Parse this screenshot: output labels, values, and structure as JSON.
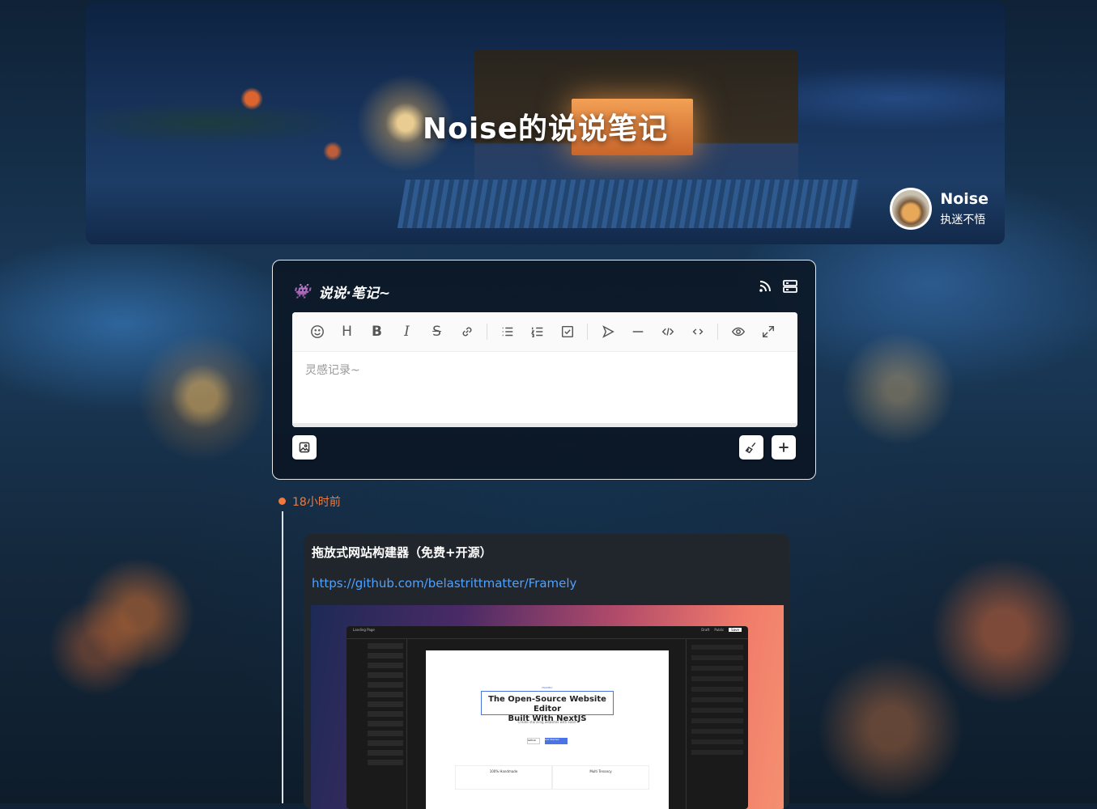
{
  "banner": {
    "title": "Noise的说说笔记"
  },
  "author": {
    "name": "Noise",
    "motto": "执迷不悟"
  },
  "card": {
    "title": "说说·笔记~",
    "placeholder": "灵感记录~"
  },
  "toolbar": {
    "icons": [
      "emoji-icon",
      "heading-icon",
      "bold-icon",
      "italic-icon",
      "strike-icon",
      "link-icon",
      "list-icon",
      "ordered-list-icon",
      "check-icon",
      "quote-icon",
      "line-icon",
      "code-icon",
      "inline-code-icon",
      "preview-icon",
      "fullscreen-icon"
    ],
    "heading": "H",
    "bold": "B",
    "italic": "I",
    "strike": "S"
  },
  "timeline": {
    "time": "18小时前"
  },
  "post": {
    "title": "拖放式网站构建器（免费+开源）",
    "link": "https://github.com/belastrittmatter/Framely",
    "preview": {
      "hero_line1": "The Open-Source Website Editor",
      "hero_line2": "Built With NextJS",
      "hero_sub": "Create stunning websites with ease!",
      "btn1": "Github",
      "btn2": "Get Started",
      "feature1": "100% Handmade",
      "feature2": "Multi Tenancy",
      "tag": "FRAMELY",
      "app_title": "Landing Page",
      "top_draft": "Draft",
      "top_public": "Public",
      "top_save": "Save"
    }
  }
}
